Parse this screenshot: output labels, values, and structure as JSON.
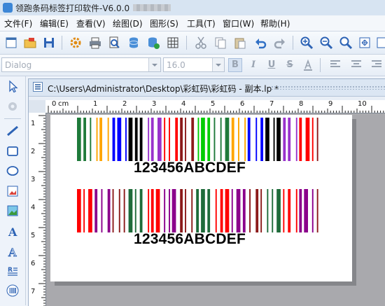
{
  "app": {
    "title": "领跑条码标签打印软件-V6.0.0",
    "icon": "app-logo-icon"
  },
  "menu": [
    {
      "label": "文件(F)"
    },
    {
      "label": "编辑(E)"
    },
    {
      "label": "查看(V)"
    },
    {
      "label": "绘图(D)"
    },
    {
      "label": "图形(S)"
    },
    {
      "label": "工具(T)"
    },
    {
      "label": "窗口(W)"
    },
    {
      "label": "帮助(H)"
    }
  ],
  "toolbar": {
    "icons": [
      "new-icon",
      "open-icon",
      "save-icon",
      "settings-icon",
      "print-icon",
      "print-preview-icon",
      "database-icon",
      "database-connect-icon",
      "grid-icon",
      "cut-icon",
      "copy-icon",
      "paste-icon",
      "undo-icon",
      "redo-icon",
      "zoom-in-icon",
      "zoom-out-icon",
      "zoom-actual-icon",
      "fit-page-icon",
      "fit-width-icon"
    ]
  },
  "format_bar": {
    "font_name": "Dialog",
    "font_size": "16.0",
    "bold": "B",
    "italic": "I",
    "underline": "U",
    "strike": "S"
  },
  "left_tools": {
    "icons": [
      "select-icon",
      "hand-icon",
      "line-icon",
      "rectangle-icon",
      "ellipse-icon",
      "image-edit-icon",
      "picture-icon",
      "text-icon",
      "outline-text-icon",
      "paragraph-text-icon",
      "barcode-icon"
    ]
  },
  "document": {
    "tab_title": "C:\\Users\\Administrator\\Desktop\\彩虹码\\彩虹码 - 副本.lp *",
    "ruler_unit": "cm",
    "ruler_h_labels": [
      "0",
      "1",
      "2",
      "3",
      "4",
      "5",
      "6",
      "7",
      "8",
      "9",
      "10"
    ],
    "ruler_v_labels": [
      "1",
      "2",
      "3",
      "4",
      "5",
      "6",
      "7"
    ]
  },
  "barcodes": [
    {
      "text": "123456ABCDEF",
      "colors": [
        "#1f7a3a",
        "#ffa500",
        "#0000ff",
        "#000000",
        "#9932cc",
        "#ff0000",
        "#8b1a1a",
        "#00cc00"
      ]
    },
    {
      "text": "123456ABCDEF",
      "colors": [
        "#ff0000",
        "#8b008b",
        "#8b1a1a",
        "#1f6b3a"
      ]
    }
  ]
}
